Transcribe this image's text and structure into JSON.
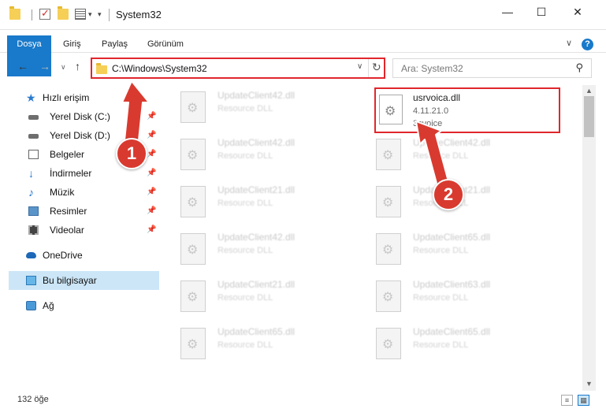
{
  "window": {
    "title": "System32",
    "controls": {
      "minimize": "—",
      "maximize": "☐",
      "close": "✕"
    }
  },
  "ribbon": {
    "tabs": [
      "Dosya",
      "Giriş",
      "Paylaş",
      "Görünüm"
    ],
    "help": "?",
    "collapse": "∨"
  },
  "nav": {
    "back": "←",
    "forward": "→",
    "recent": "∨",
    "up": "↑",
    "address": "C:\\Windows\\System32",
    "address_dropdown": "∨",
    "refresh": "↻",
    "search_placeholder": "Ara: System32",
    "search_icon": "⚲"
  },
  "sidebar": {
    "items": [
      {
        "label": "Hızlı erişim",
        "icon": "star-icon",
        "pin": ""
      },
      {
        "label": "Yerel Disk (C:)",
        "icon": "drive-icon",
        "pin": "📌"
      },
      {
        "label": "Yerel Disk (D:)",
        "icon": "drive-icon",
        "pin": "📌"
      },
      {
        "label": "Belgeler",
        "icon": "document-icon",
        "pin": "📌"
      },
      {
        "label": "İndirmeler",
        "icon": "download-icon",
        "pin": "📌"
      },
      {
        "label": "Müzik",
        "icon": "music-icon",
        "pin": "📌"
      },
      {
        "label": "Resimler",
        "icon": "pictures-icon",
        "pin": "📌"
      },
      {
        "label": "Videolar",
        "icon": "video-icon",
        "pin": "📌"
      },
      {
        "label": "OneDrive",
        "icon": "cloud-icon",
        "pin": ""
      },
      {
        "label": "Bu bilgisayar",
        "icon": "computer-icon",
        "pin": ""
      },
      {
        "label": "Ağ",
        "icon": "network-icon",
        "pin": ""
      }
    ]
  },
  "files": {
    "left_column": [
      {
        "name": "UpdateClient42.dll",
        "desc": "Resource DLL"
      },
      {
        "name": "UpdateClient42.dll",
        "desc": "Resource DLL"
      },
      {
        "name": "UpdateClient21.dll",
        "desc": "Resource DLL"
      },
      {
        "name": "UpdateClient42.dll",
        "desc": "Resource DLL"
      },
      {
        "name": "UpdateClient21.dll",
        "desc": "Resource DLL"
      },
      {
        "name": "UpdateClient65.dll",
        "desc": "Resource DLL"
      }
    ],
    "highlighted": {
      "name": "usrvoica.dll",
      "version": "4.11.21.0",
      "desc": "3cvoice"
    },
    "right_column": [
      {
        "name": "UpdateClient42.dll",
        "desc": "Resource DLL"
      },
      {
        "name": "UpdateClient21.dll",
        "desc": "Resource DLL"
      },
      {
        "name": "UpdateClient65.dll",
        "desc": "Resource DLL"
      },
      {
        "name": "UpdateClient63.dll",
        "desc": "Resource DLL"
      },
      {
        "name": "UpdateClient65.dll",
        "desc": "Resource DLL"
      }
    ]
  },
  "status": {
    "count": "132 öğe"
  },
  "callouts": {
    "first": "1",
    "second": "2"
  },
  "colors": {
    "accent": "#1979ca",
    "highlight": "#e0272c",
    "selection": "#cce6f7"
  }
}
